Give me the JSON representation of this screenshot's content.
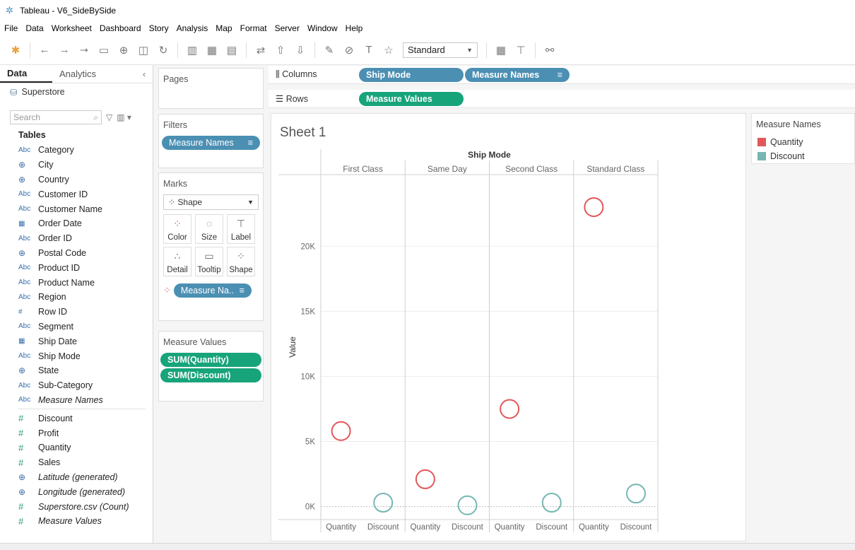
{
  "window": {
    "title": "Tableau - V6_SideBySide"
  },
  "menu": [
    "File",
    "Data",
    "Worksheet",
    "Dashboard",
    "Story",
    "Analysis",
    "Map",
    "Format",
    "Server",
    "Window",
    "Help"
  ],
  "toolbar": {
    "fit_value": "Standard"
  },
  "left_pane": {
    "tabs": [
      "Data",
      "Analytics"
    ],
    "datasource": "Superstore",
    "search_placeholder": "Search",
    "tables_heading": "Tables",
    "dimensions": [
      {
        "type": "Abc",
        "name": "Category"
      },
      {
        "type": "geo",
        "name": "City"
      },
      {
        "type": "geo",
        "name": "Country"
      },
      {
        "type": "Abc",
        "name": "Customer ID"
      },
      {
        "type": "Abc",
        "name": "Customer Name"
      },
      {
        "type": "date",
        "name": "Order Date"
      },
      {
        "type": "Abc",
        "name": "Order ID"
      },
      {
        "type": "geo",
        "name": "Postal Code"
      },
      {
        "type": "Abc",
        "name": "Product ID"
      },
      {
        "type": "Abc",
        "name": "Product Name"
      },
      {
        "type": "Abc",
        "name": "Region"
      },
      {
        "type": "#",
        "name": "Row ID"
      },
      {
        "type": "Abc",
        "name": "Segment"
      },
      {
        "type": "date",
        "name": "Ship Date"
      },
      {
        "type": "Abc",
        "name": "Ship Mode"
      },
      {
        "type": "geo",
        "name": "State"
      },
      {
        "type": "Abc",
        "name": "Sub-Category"
      },
      {
        "type": "Abc",
        "name": "Measure Names",
        "italic": true
      }
    ],
    "measures": [
      {
        "type": "#",
        "name": "Discount"
      },
      {
        "type": "#",
        "name": "Profit"
      },
      {
        "type": "#",
        "name": "Quantity"
      },
      {
        "type": "#",
        "name": "Sales"
      },
      {
        "type": "geo",
        "name": "Latitude (generated)",
        "italic": true
      },
      {
        "type": "geo",
        "name": "Longitude (generated)",
        "italic": true
      },
      {
        "type": "#",
        "name": "Superstore.csv (Count)",
        "italic": true
      },
      {
        "type": "#",
        "name": "Measure Values",
        "italic": true
      }
    ]
  },
  "shelves": {
    "pages_title": "Pages",
    "filters_title": "Filters",
    "filters": [
      "Measure Names"
    ],
    "marks_title": "Marks",
    "mark_type": "Shape",
    "mark_buttons": [
      "Color",
      "Size",
      "Label",
      "Detail",
      "Tooltip",
      "Shape"
    ],
    "marks_pill": "Measure Na..",
    "measure_values_title": "Measure Values",
    "measure_values": [
      "SUM(Quantity)",
      "SUM(Discount)"
    ],
    "columns_label": "Columns",
    "columns": [
      "Ship Mode",
      "Measure Names"
    ],
    "rows_label": "Rows",
    "rows": [
      "Measure Values"
    ]
  },
  "legend": {
    "title": "Measure Names",
    "items": [
      {
        "name": "Quantity",
        "color": "#e15759"
      },
      {
        "name": "Discount",
        "color": "#76b7b2"
      }
    ]
  },
  "chart_data": {
    "type": "scatter",
    "title": "Sheet 1",
    "column_header": "Ship Mode",
    "categories": [
      "First Class",
      "Same Day",
      "Second Class",
      "Standard Class"
    ],
    "sub_categories": [
      "Quantity",
      "Discount"
    ],
    "ylabel": "Value",
    "ylim": [
      -1000,
      25500
    ],
    "yticks": [
      0,
      5000,
      10000,
      15000,
      20000
    ],
    "ytick_labels": [
      "0K",
      "5K",
      "10K",
      "15K",
      "20K"
    ],
    "series": [
      {
        "name": "Quantity",
        "color": "#e15759",
        "values": [
          5800,
          2100,
          7500,
          23000
        ]
      },
      {
        "name": "Discount",
        "color": "#76b7b2",
        "values": [
          300,
          100,
          300,
          1000
        ]
      }
    ]
  }
}
